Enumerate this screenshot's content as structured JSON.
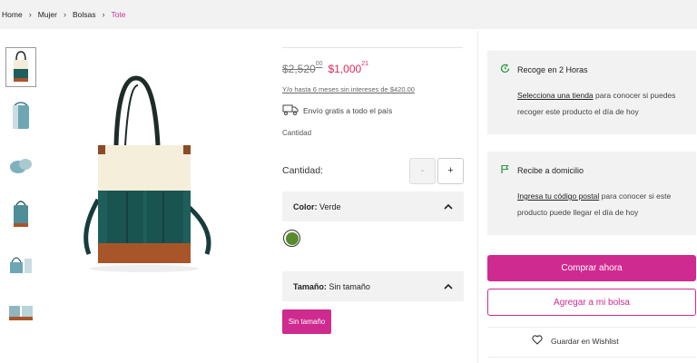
{
  "breadcrumb": {
    "items": [
      "Home",
      "Mujer",
      "Bolsas",
      "Tote"
    ]
  },
  "product": {
    "old_price": "$2,520",
    "old_price_cents": "00",
    "new_price": "$1,000",
    "new_price_cents": "21",
    "msi_text": "Y/o hasta 6 meses sin intereses de $420.00",
    "shipping_text": "Envío gratis a todo el país",
    "cantidad_label": "Cantidad",
    "qty_label": "Cantidad:",
    "qty_minus": "-",
    "qty_plus": "+",
    "color_key": "Color:",
    "color_value": "Verde",
    "swatch_color": "#5a8a2e",
    "size_key": "Tamaño:",
    "size_value": "Sin tamaño",
    "size_chip": "Sin tamaño"
  },
  "pickup": {
    "title": "Recoge en 2 Horas",
    "link": "Selecciona una tienda",
    "text": "para conocer si puedes recoger este producto el día de hoy"
  },
  "delivery": {
    "title": "Recibe a domicilio",
    "link": "Ingresa tu código postal",
    "text": "para conocer si este producto puede llegar el día de hoy"
  },
  "actions": {
    "buy_now": "Comprar ahora",
    "add_to_bag": "Agregar a mi bolsa",
    "wishlist": "Guardar en Wishlist"
  },
  "colors": {
    "accent": "#cf2a8f",
    "sale_price": "#e0285a",
    "icon_green": "#2e9b46"
  }
}
